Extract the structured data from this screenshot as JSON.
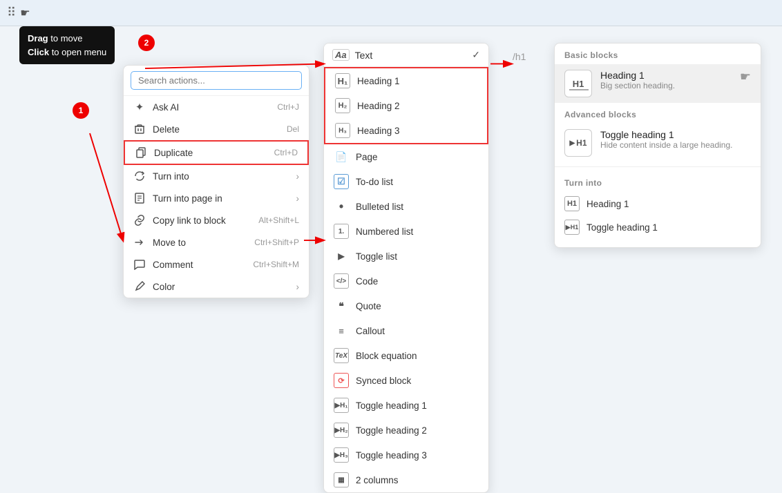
{
  "topbar": {
    "badge1": "1",
    "badge2": "2"
  },
  "tooltip": {
    "drag_text": "Drag",
    "drag_suffix": " to move",
    "click_text": "Click",
    "click_suffix": " to open menu"
  },
  "slash_hint": "/h1",
  "context_menu": {
    "search_placeholder": "Search actions...",
    "items": [
      {
        "icon": "✦",
        "label": "Ask AI",
        "shortcut": "Ctrl+J"
      },
      {
        "icon": "🗑",
        "label": "Delete",
        "shortcut": "Del"
      },
      {
        "icon": "⧉",
        "label": "Duplicate",
        "shortcut": "Ctrl+D",
        "highlighted": true
      },
      {
        "icon": "↻",
        "label": "Turn into",
        "arrow": true
      },
      {
        "icon": "📄",
        "label": "Turn into page in",
        "arrow": true
      },
      {
        "icon": "🔗",
        "label": "Copy link to block",
        "shortcut": "Alt+Shift+L"
      },
      {
        "icon": "↗",
        "label": "Move to",
        "shortcut": "Ctrl+Shift+P"
      },
      {
        "icon": "💬",
        "label": "Comment",
        "shortcut": "Ctrl+Shift+M"
      },
      {
        "icon": "🎨",
        "label": "Color",
        "arrow": true
      }
    ]
  },
  "dropdown": {
    "header_label": "Text",
    "items": [
      {
        "icon": "H1",
        "label": "Heading 1",
        "heading": true
      },
      {
        "icon": "H2",
        "label": "Heading 2",
        "heading": true
      },
      {
        "icon": "H3",
        "label": "Heading 3",
        "heading": true
      },
      {
        "icon": "📄",
        "label": "Page"
      },
      {
        "icon": "☑",
        "label": "To-do list"
      },
      {
        "icon": "•",
        "label": "Bulleted list"
      },
      {
        "icon": "1.",
        "label": "Numbered list"
      },
      {
        "icon": "▶",
        "label": "Toggle list"
      },
      {
        "icon": "</>",
        "label": "Code"
      },
      {
        "icon": "❝",
        "label": "Quote"
      },
      {
        "icon": "📢",
        "label": "Callout"
      },
      {
        "icon": "TeX",
        "label": "Block equation"
      },
      {
        "icon": "⟳",
        "label": "Synced block"
      },
      {
        "icon": "▶H1",
        "label": "Toggle heading 1"
      },
      {
        "icon": "▶H2",
        "label": "Toggle heading 2"
      },
      {
        "icon": "▶H3",
        "label": "Toggle heading 3"
      },
      {
        "icon": "▦",
        "label": "2 columns"
      }
    ]
  },
  "right_panel": {
    "basic_blocks_title": "Basic blocks",
    "heading1_name": "Heading 1",
    "heading1_desc": "Big section heading.",
    "advanced_blocks_title": "Advanced blocks",
    "toggle_heading1_name": "Toggle heading 1",
    "toggle_heading1_desc": "Hide content inside a large heading.",
    "turn_into_title": "Turn into",
    "turn_into_heading1": "Heading 1",
    "turn_into_toggle_heading1": "Toggle heading 1"
  }
}
